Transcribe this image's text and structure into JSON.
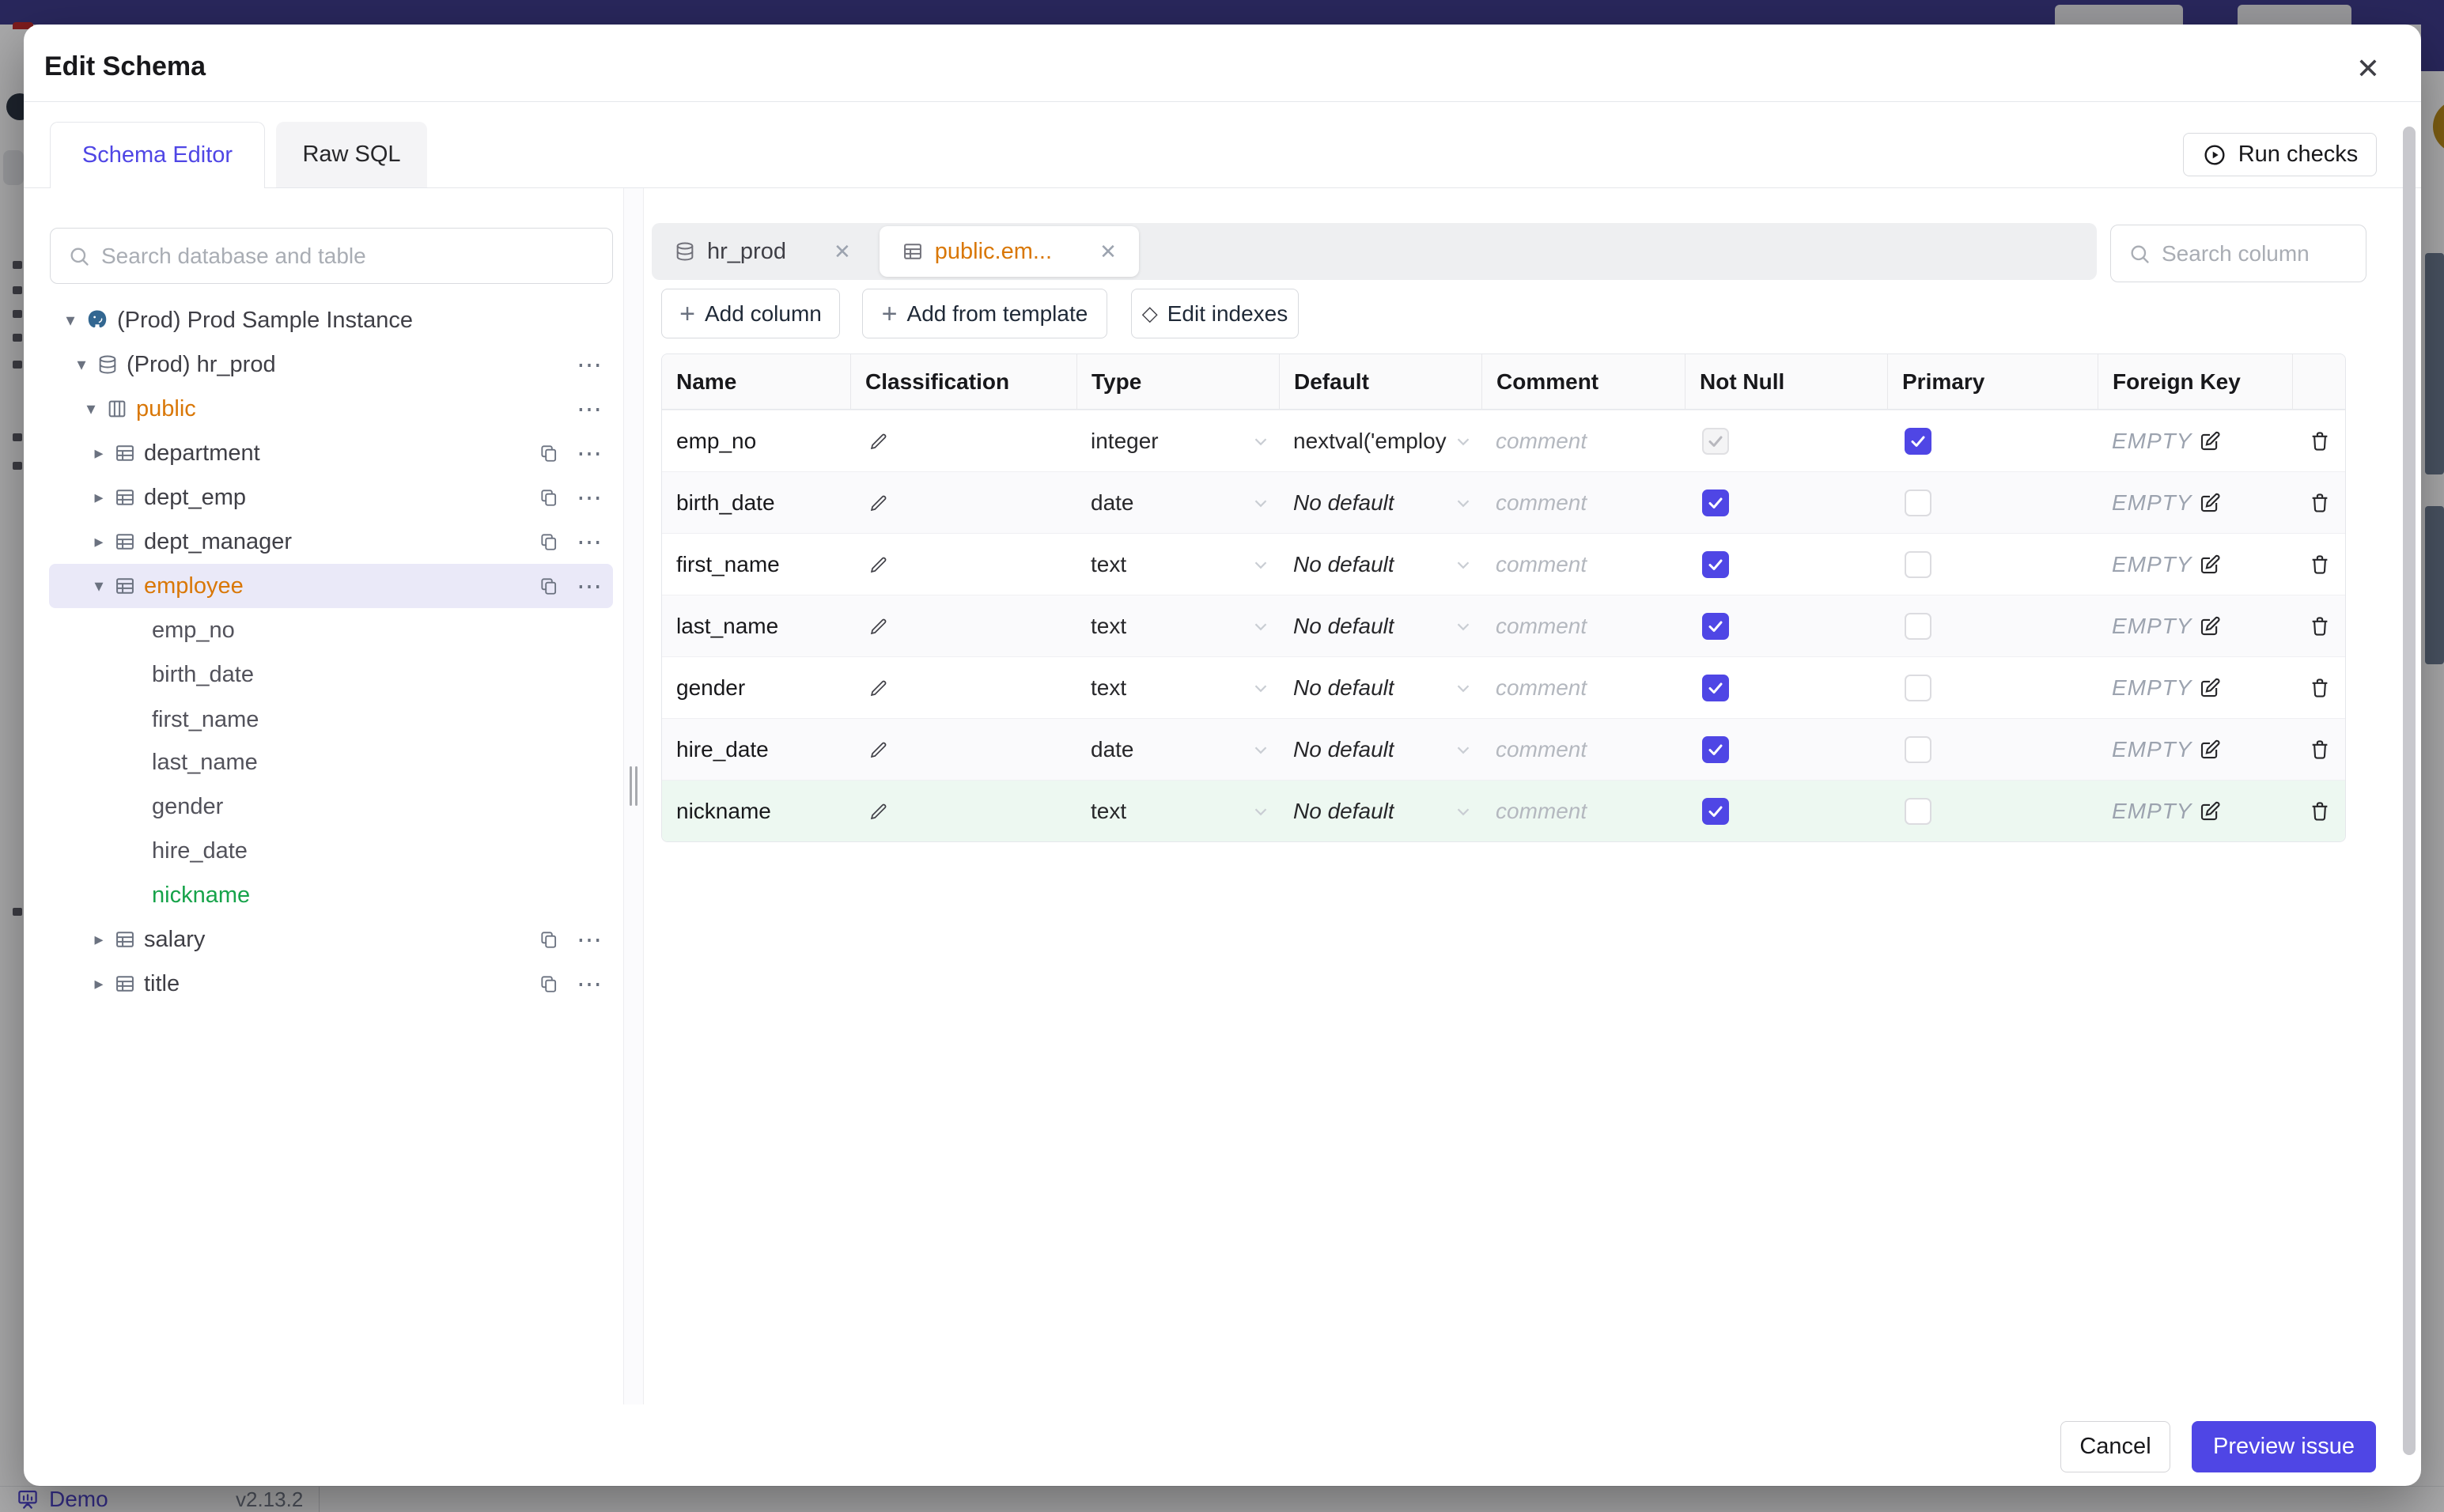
{
  "colors": {
    "accent": "#4F46E5",
    "modified_orange": "#D97706",
    "added_green": "#16A34A",
    "topbar": "#312E81"
  },
  "icons": {
    "caret_down": "▾",
    "caret_right": "▸",
    "ellipsis": "⋯",
    "plus": "+",
    "diamond": "◇",
    "close": "✕"
  },
  "modal": {
    "title": "Edit Schema",
    "tabs": [
      {
        "label": "Schema Editor",
        "active": true
      },
      {
        "label": "Raw SQL",
        "active": false
      }
    ],
    "run_checks_label": "Run checks"
  },
  "sidebar": {
    "search_placeholder": "Search database and table",
    "rows": [
      {
        "label": "(Prod) Prod Sample Instance",
        "type": "instance"
      },
      {
        "label": "(Prod) hr_prod",
        "type": "database"
      },
      {
        "label": "public",
        "type": "schema",
        "status": "modified"
      },
      {
        "label": "department",
        "type": "table"
      },
      {
        "label": "dept_emp",
        "type": "table"
      },
      {
        "label": "dept_manager",
        "type": "table"
      },
      {
        "label": "employee",
        "type": "table",
        "status": "modified",
        "selected": true
      },
      {
        "label": "emp_no",
        "type": "column"
      },
      {
        "label": "birth_date",
        "type": "column"
      },
      {
        "label": "first_name",
        "type": "column"
      },
      {
        "label": "last_name",
        "type": "column"
      },
      {
        "label": "gender",
        "type": "column"
      },
      {
        "label": "hire_date",
        "type": "column"
      },
      {
        "label": "nickname",
        "type": "column",
        "status": "added"
      },
      {
        "label": "salary",
        "type": "table"
      },
      {
        "label": "title",
        "type": "table"
      }
    ]
  },
  "main": {
    "tabs": [
      {
        "label": "hr_prod",
        "type": "database"
      },
      {
        "label": "public.em...",
        "type": "table",
        "active": true
      }
    ],
    "search_placeholder": "Search column",
    "toolbar": {
      "add_column": "Add column",
      "add_from_template": "Add from template",
      "edit_indexes": "Edit indexes"
    },
    "table": {
      "headers": [
        "Name",
        "Classification",
        "Type",
        "Default",
        "Comment",
        "Not Null",
        "Primary",
        "Foreign Key"
      ],
      "comment_placeholder": "comment",
      "rows": [
        {
          "name": "emp_no",
          "type": "integer",
          "default": "nextval('employ",
          "default_is_placeholder": false,
          "not_null": true,
          "not_null_disabled": true,
          "primary": true,
          "foreign_key": "EMPTY",
          "added": false
        },
        {
          "name": "birth_date",
          "type": "date",
          "default": "No default",
          "default_is_placeholder": true,
          "not_null": true,
          "not_null_disabled": false,
          "primary": false,
          "foreign_key": "EMPTY",
          "added": false
        },
        {
          "name": "first_name",
          "type": "text",
          "default": "No default",
          "default_is_placeholder": true,
          "not_null": true,
          "not_null_disabled": false,
          "primary": false,
          "foreign_key": "EMPTY",
          "added": false
        },
        {
          "name": "last_name",
          "type": "text",
          "default": "No default",
          "default_is_placeholder": true,
          "not_null": true,
          "not_null_disabled": false,
          "primary": false,
          "foreign_key": "EMPTY",
          "added": false
        },
        {
          "name": "gender",
          "type": "text",
          "default": "No default",
          "default_is_placeholder": true,
          "not_null": true,
          "not_null_disabled": false,
          "primary": false,
          "foreign_key": "EMPTY",
          "added": false
        },
        {
          "name": "hire_date",
          "type": "date",
          "default": "No default",
          "default_is_placeholder": true,
          "not_null": true,
          "not_null_disabled": false,
          "primary": false,
          "foreign_key": "EMPTY",
          "added": false
        },
        {
          "name": "nickname",
          "type": "text",
          "default": "No default",
          "default_is_placeholder": true,
          "not_null": true,
          "not_null_disabled": false,
          "primary": false,
          "foreign_key": "EMPTY",
          "added": true
        }
      ]
    }
  },
  "footer": {
    "cancel": "Cancel",
    "preview": "Preview issue"
  },
  "page_background": {
    "brand": "Demo",
    "version": "v2.13.2"
  }
}
